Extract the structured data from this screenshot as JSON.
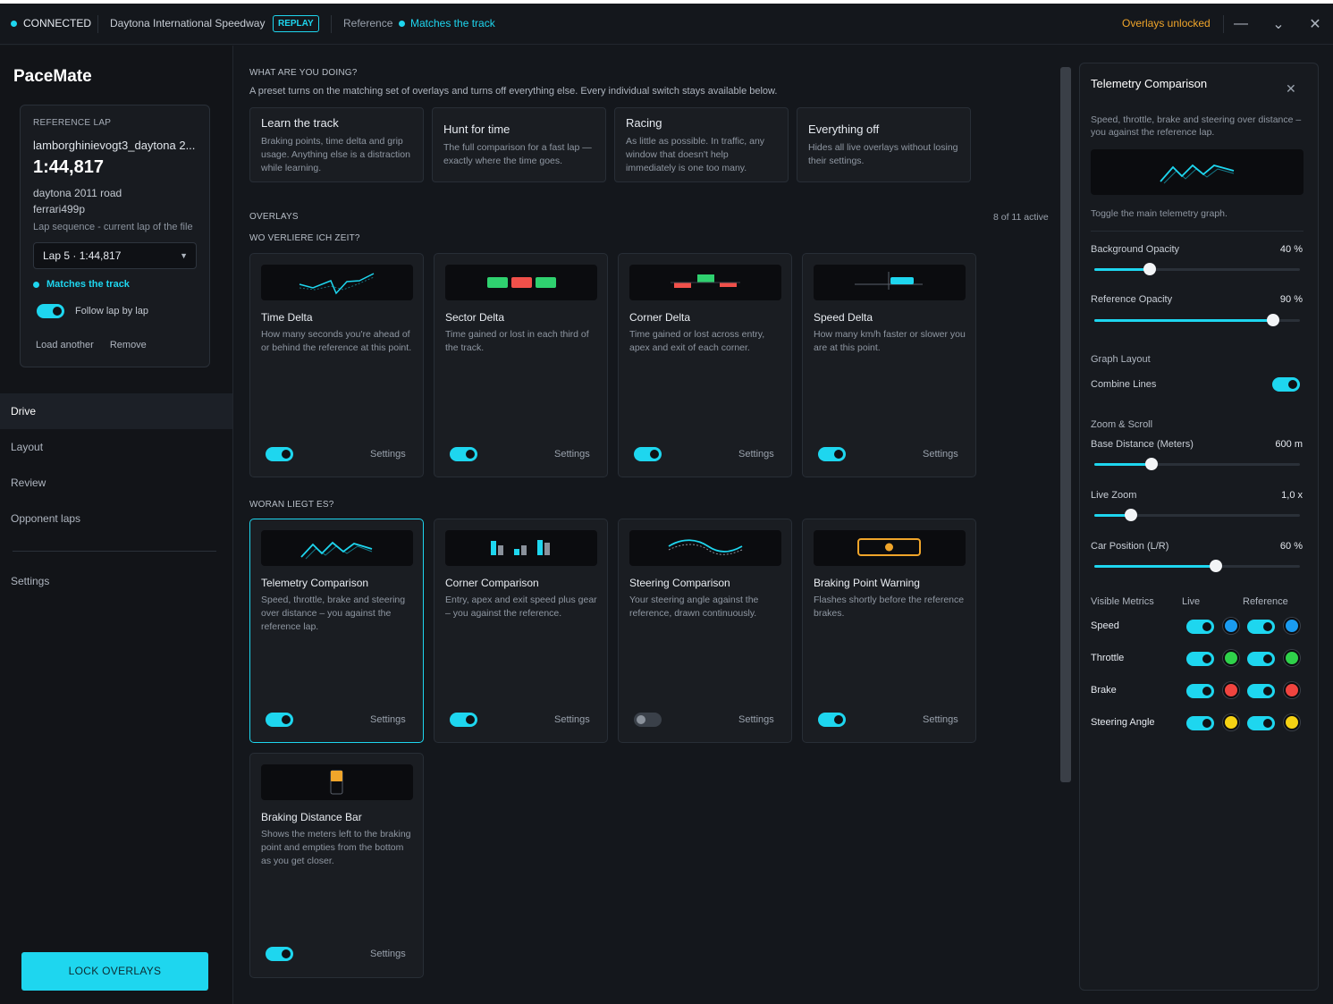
{
  "topbar": {
    "status": "CONNECTED",
    "track": "Daytona International Speedway",
    "mode_badge": "REPLAY",
    "reference_label": "Reference",
    "reference_status": "Matches the track",
    "overlays_status": "Overlays unlocked",
    "minimize": "—",
    "collapse": "⌄",
    "close": "✕"
  },
  "sidebar": {
    "brand": "PaceMate",
    "reference": {
      "label": "REFERENCE LAP",
      "file": "lamborghinievogt3_daytona 2...",
      "time": "1:44,817",
      "track": "daytona 2011 road",
      "car": "ferrari499p",
      "sequence_label": "Lap sequence - current lap of the file",
      "lap_select": "Lap 5  ·  1:44,817",
      "match": "Matches the track",
      "follow": "Follow lap by lap",
      "load": "Load another",
      "remove": "Remove"
    },
    "nav": [
      {
        "label": "Drive",
        "active": true
      },
      {
        "label": "Layout"
      },
      {
        "label": "Review"
      },
      {
        "label": "Opponent laps"
      }
    ],
    "settings": "Settings",
    "lock": "LOCK OVERLAYS"
  },
  "main": {
    "presets_heading": "WHAT ARE YOU DOING?",
    "presets_desc": "A preset turns on the matching set of overlays and turns off everything else. Every individual switch stays available below.",
    "presets": [
      {
        "title": "Learn the track",
        "desc": "Braking points, time delta and grip usage. Anything else is a distraction while learning."
      },
      {
        "title": "Hunt for time",
        "desc": "The full comparison for a fast lap — exactly where the time goes."
      },
      {
        "title": "Racing",
        "desc": "As little as possible. In traffic, any window that doesn't help immediately is one too many."
      },
      {
        "title": "Everything off",
        "desc": "Hides all live overlays without losing their settings."
      }
    ],
    "overlays_heading": "OVERLAYS",
    "active_count": "8 of 11 active",
    "group1": "WO VERLIERE ICH ZEIT?",
    "group2": "WORAN LIEGT ES?",
    "settings_label": "Settings",
    "cards": [
      {
        "title": "Time Delta",
        "desc": "How many seconds you're ahead of or behind the reference at this point.",
        "on": true
      },
      {
        "title": "Sector Delta",
        "desc": "Time gained or lost in each third of the track.",
        "on": true
      },
      {
        "title": "Corner Delta",
        "desc": "Time gained or lost across entry, apex and exit of each corner.",
        "on": true
      },
      {
        "title": "Speed Delta",
        "desc": "How many km/h faster or slower you are at this point.",
        "on": true
      },
      {
        "title": "Telemetry Comparison",
        "desc": "Speed, throttle, brake and steering over distance – you against the reference lap.",
        "on": true
      },
      {
        "title": "Corner Comparison",
        "desc": "Entry, apex and exit speed plus gear – you against the reference.",
        "on": true
      },
      {
        "title": "Steering Comparison",
        "desc": "Your steering angle against the reference, drawn continuously.",
        "on": false
      },
      {
        "title": "Braking Point Warning",
        "desc": "Flashes shortly before the reference brakes.",
        "on": true
      },
      {
        "title": "Braking Distance Bar",
        "desc": "Shows the meters left to the braking point and empties from the bottom as you get closer.",
        "on": true
      }
    ]
  },
  "panel": {
    "title": "Telemetry Comparison",
    "close": "✕",
    "desc": "Speed, throttle, brake and steering over distance – you against the reference lap.",
    "toggle_desc": "Toggle the main telemetry graph.",
    "bg_opacity": {
      "label": "Background Opacity",
      "value": "40 %",
      "level": 0.27
    },
    "ref_opacity": {
      "label": "Reference Opacity",
      "value": "90 %",
      "level": 0.87
    },
    "graph_layout": "Graph Layout",
    "combine_lines": "Combine Lines",
    "zoom_scroll": "Zoom & Scroll",
    "base_distance": {
      "label": "Base Distance (Meters)",
      "value": "600 m",
      "level": 0.28
    },
    "live_zoom": {
      "label": "Live Zoom",
      "value": "1,0 x",
      "level": 0.18
    },
    "car_position": {
      "label": "Car Position (L/R)",
      "value": "60 %",
      "level": 0.59
    },
    "visible_metrics": "Visible Metrics",
    "live": "Live",
    "reference": "Reference",
    "metrics": [
      {
        "name": "Speed",
        "color": "#1a9bf0"
      },
      {
        "name": "Throttle",
        "color": "#2fd14a"
      },
      {
        "name": "Brake",
        "color": "#f0443f"
      },
      {
        "name": "Steering Angle",
        "color": "#f5d214"
      }
    ]
  }
}
